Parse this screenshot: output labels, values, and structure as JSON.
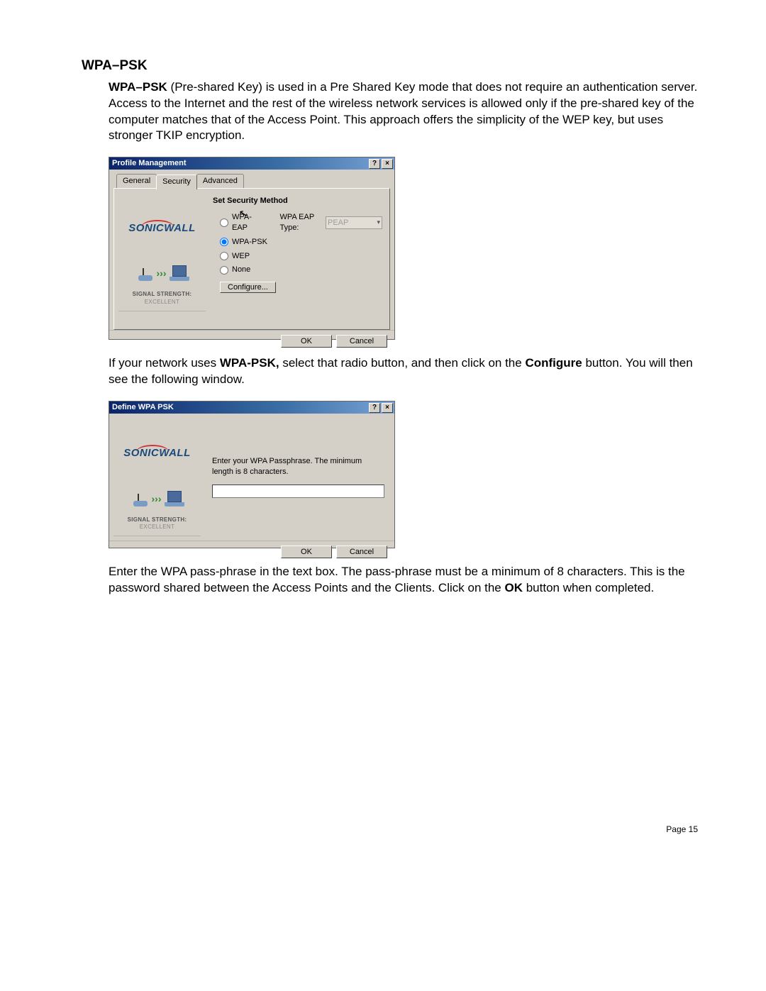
{
  "doc": {
    "heading": "WPA–PSK",
    "para1_lead": "WPA–PSK",
    "para1_rest": " (Pre-shared Key) is used in a Pre Shared Key mode that does not require an authentication server. Access to the Internet and the rest of the wireless network services is allowed only if the pre-shared key of the computer matches that of the Access Point. This approach offers the simplicity of the WEP key, but uses stronger TKIP encryption.",
    "para2_a": "If your network uses ",
    "para2_b": "WPA-PSK,",
    "para2_c": " select that radio button, and then click on the ",
    "para2_d": "Configure",
    "para2_e": " button. You will then see the following window.",
    "para3_a": "Enter the WPA pass-phrase in the text box. The pass-phrase must be a minimum of 8 characters. This is the password shared between the Access Points and the Clients. Click on the ",
    "para3_b": "OK",
    "para3_c": " button when completed.",
    "page_num": "Page 15"
  },
  "common": {
    "logo": "SONICWALL",
    "signal_label": "SIGNAL STRENGTH:",
    "signal_value": " EXCELLENT",
    "help_btn": "?",
    "close_btn": "×",
    "ok": "OK",
    "cancel": "Cancel"
  },
  "dlg1": {
    "title": "Profile Management",
    "tabs": {
      "general": "General",
      "security": "Security",
      "advanced": "Advanced"
    },
    "group_title": "Set Security Method",
    "opt_wpa_eap": "WPA-EAP",
    "eap_type_label": "WPA EAP Type:",
    "eap_type_value": "PEAP",
    "opt_wpa_psk": "WPA-PSK",
    "opt_wep": "WEP",
    "opt_none": "None",
    "configure": "Configure..."
  },
  "dlg2": {
    "title": "Define WPA PSK",
    "prompt": "Enter your WPA Passphrase.  The minimum length is 8 characters.",
    "value": ""
  }
}
